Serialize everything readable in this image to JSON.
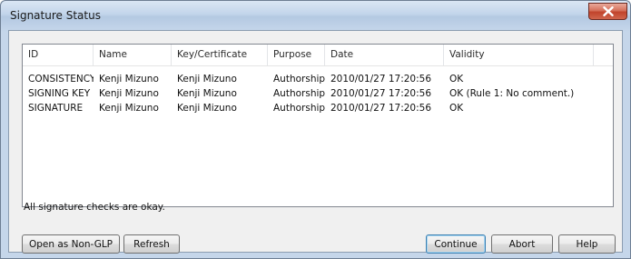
{
  "window": {
    "title": "Signature Status"
  },
  "list": {
    "columns": [
      "ID",
      "Name",
      "Key/Certificate",
      "Purpose",
      "Date",
      "Validity"
    ],
    "rows": [
      {
        "id": "CONSISTENCY",
        "name": "Kenji Mizuno",
        "key": "Kenji Mizuno",
        "purpose": "Authorship",
        "date": "2010/01/27 17:20:56",
        "validity": "OK"
      },
      {
        "id": "SIGNING KEY",
        "name": "Kenji Mizuno",
        "key": "Kenji Mizuno",
        "purpose": "Authorship",
        "date": "2010/01/27 17:20:56",
        "validity": "OK (Rule 1: No comment.)"
      },
      {
        "id": "SIGNATURE",
        "name": "Kenji Mizuno",
        "key": "Kenji Mizuno",
        "purpose": "Authorship",
        "date": "2010/01/27 17:20:56",
        "validity": "OK"
      }
    ]
  },
  "status": "All signature checks are okay.",
  "buttons": {
    "open_non_glp": "Open as Non-GLP",
    "refresh": "Refresh",
    "continue": "Continue",
    "abort": "Abort",
    "help": "Help"
  },
  "icons": {
    "close": "close-icon"
  }
}
